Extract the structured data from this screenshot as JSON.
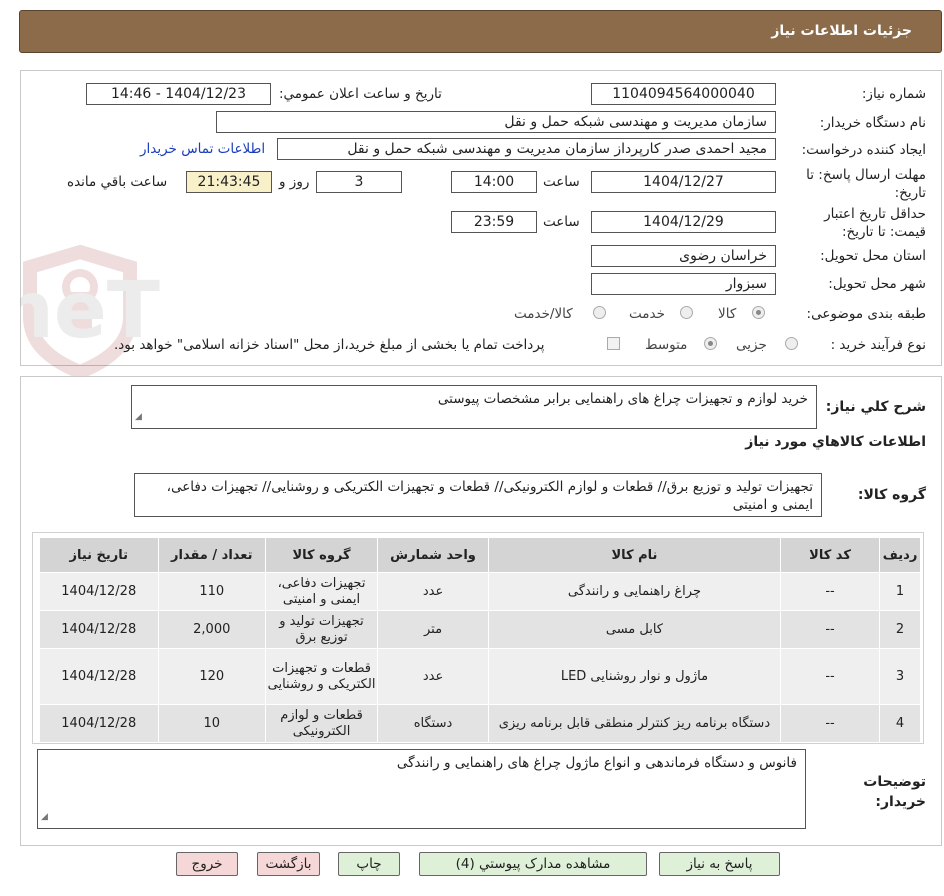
{
  "header": {
    "title": "جزئیات اطلاعات نیاز"
  },
  "form": {
    "need_number_label": "شماره نیاز:",
    "need_number": "1104094564000040",
    "announce_label": "تاریخ و ساعت اعلان عمومي:",
    "announce_value": "1404/12/23 - 14:46",
    "buyer_org_label": "نام دستگاه خریدار:",
    "buyer_org": "سازمان مدیریت و مهندسی شبکه حمل و نقل",
    "creator_label": "ایجاد کننده درخواست:",
    "creator": "مجید احمدی صدر کارپرداز سازمان مدیریت و مهندسی شبکه حمل و نقل",
    "contact_link": "اطلاعات تماس خریدار",
    "deadline_label": "مهلت ارسال پاسخ: تا تاریخ:",
    "deadline_date": "1404/12/27",
    "time_label": "ساعت",
    "deadline_time": "14:00",
    "days_value": "3",
    "days_label": "روز و",
    "remaining_value": "21:43:45",
    "remaining_label": "ساعت باقي مانده",
    "validity_label": "حداقل تاریخ اعتبار قیمت: تا تاریخ:",
    "validity_date": "1404/12/29",
    "validity_time": "23:59",
    "province_label": "استان محل تحویل:",
    "province": "خراسان رضوی",
    "city_label": "شهر محل تحویل:",
    "city": "سبزوار",
    "category_label": "طبقه بندی موضوعی:",
    "category_options": [
      "کالا",
      "خدمت",
      "کالا/خدمت"
    ],
    "process_label": "نوع فرآیند خرید :",
    "process_options": [
      "جزیی",
      "متوسط"
    ],
    "payment_note": "پرداخت تمام یا بخشی از مبلغ خرید،از محل \"اسناد خزانه اسلامی\" خواهد بود."
  },
  "details": {
    "summary_label": "شرح کلي نیاز:",
    "summary": "خرید لوازم و تجهیزات چراغ های راهنمایی برابر مشخصات پیوستی",
    "goods_info_title": "اطلاعات کالاهاي مورد نیاز",
    "goods_group_label": "گروه کالا:",
    "goods_group": "تجهیزات تولید و توزیع برق// قطعات و لوازم الکترونیکی// قطعات و تجهیزات الکتریکی و روشنایی// تجهیزات دفاعی، ایمنی و امنیتی",
    "table": {
      "headers": [
        "ردیف",
        "کد کالا",
        "نام کالا",
        "واحد شمارش",
        "گروه کالا",
        "تعداد / مقدار",
        "تاریخ نیاز"
      ],
      "rows": [
        [
          "1",
          "--",
          "چراغ راهنمایی و رانندگی",
          "عدد",
          "تجهیزات دفاعی، ایمنی و امنیتی",
          "110",
          "1404/12/28"
        ],
        [
          "2",
          "--",
          "کابل مسی",
          "متر",
          "تجهیزات تولید و توزیع برق",
          "2,000",
          "1404/12/28"
        ],
        [
          "3",
          "--",
          "ماژول و نوار روشنایی LED",
          "عدد",
          "قطعات و تجهیزات الکتریکی و روشنایی",
          "120",
          "1404/12/28"
        ],
        [
          "4",
          "--",
          "دستگاه برنامه ریز کنترلر منطقی قابل برنامه ریزی",
          "دستگاه",
          "قطعات و لوازم الکترونیکی",
          "10",
          "1404/12/28"
        ]
      ]
    },
    "buyer_notes_label": "توضیحات خریدار:",
    "buyer_notes": "فانوس  و دستگاه فرماندهی  و انواع ماژول چراغ های راهنمایی و رانندگی"
  },
  "buttons": {
    "reply": "پاسخ به نیاز",
    "attachments": "مشاهده مدارک پیوستي (4)",
    "print": "چاپ",
    "back": "بازگشت",
    "exit": "خروج"
  },
  "watermark": {
    "text": "AriaTender.neT"
  },
  "colors": {
    "header": "#8b6b4a",
    "link": "#1a3dbd",
    "remaining_bg": "#f7f0c8",
    "button_green": "#dff0d8",
    "button_pink": "#f5d7d7"
  }
}
